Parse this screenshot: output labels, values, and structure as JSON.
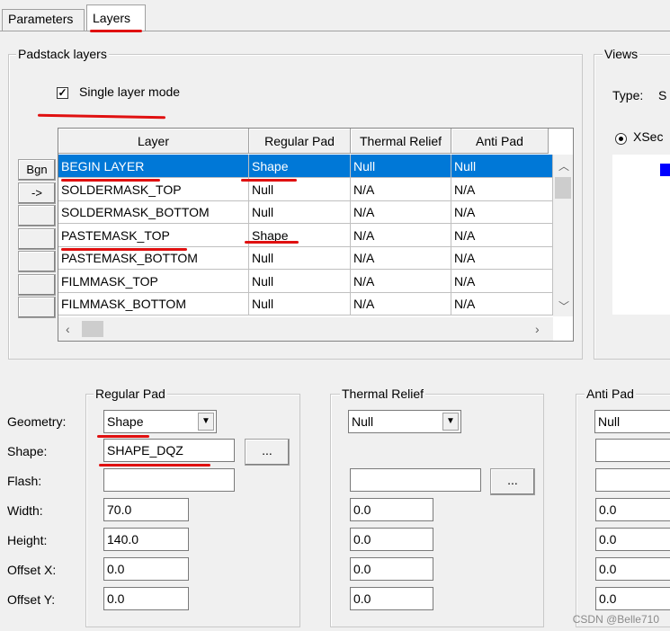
{
  "tabs": [
    "Parameters",
    "Layers"
  ],
  "padstack_layers": {
    "legend": "Padstack layers",
    "single_layer_mode": "Single layer mode",
    "columns": [
      "Layer",
      "Regular Pad",
      "Thermal Relief",
      "Anti Pad"
    ],
    "rows": [
      [
        "BEGIN LAYER",
        "Shape",
        "Null",
        "Null"
      ],
      [
        "SOLDERMASK_TOP",
        "Null",
        "N/A",
        "N/A"
      ],
      [
        "SOLDERMASK_BOTTOM",
        "Null",
        "N/A",
        "N/A"
      ],
      [
        "PASTEMASK_TOP",
        "Shape",
        "N/A",
        "N/A"
      ],
      [
        "PASTEMASK_BOTTOM",
        "Null",
        "N/A",
        "N/A"
      ],
      [
        "FILMMASK_TOP",
        "Null",
        "N/A",
        "N/A"
      ],
      [
        "FILMMASK_BOTTOM",
        "Null",
        "N/A",
        "N/A"
      ]
    ],
    "side_buttons": [
      "Bgn",
      "->",
      "",
      "",
      "",
      "",
      ""
    ]
  },
  "views": {
    "legend": "Views",
    "type_label": "Type:",
    "type_value": "S",
    "radio_label": "XSec"
  },
  "labels": {
    "geometry": "Geometry:",
    "shape": "Shape:",
    "flash": "Flash:",
    "width": "Width:",
    "height": "Height:",
    "offset_x": "Offset X:",
    "offset_y": "Offset Y:"
  },
  "regular_pad": {
    "legend": "Regular Pad",
    "geometry": "Shape",
    "shape": "SHAPE_DQZ",
    "flash": "",
    "width": "70.0",
    "height": "140.0",
    "offset_x": "0.0",
    "offset_y": "0.0",
    "browse": "..."
  },
  "thermal_relief": {
    "legend": "Thermal Relief",
    "geometry": "Null",
    "flash": "",
    "width": "0.0",
    "height": "0.0",
    "offset_x": "0.0",
    "offset_y": "0.0",
    "browse": "..."
  },
  "anti_pad": {
    "legend": "Anti Pad",
    "geometry": "Null",
    "width": "0.0",
    "height": "0.0",
    "offset_x": "0.0",
    "offset_y": "0.0"
  },
  "watermark": "CSDN @Belle710",
  "colors": {
    "selection": "#0078d7",
    "annotation": "#e01010",
    "preview_marker": "#0000ff"
  },
  "icons": {
    "dropdown": "chevron-down-icon",
    "check": "checkmark-icon"
  }
}
